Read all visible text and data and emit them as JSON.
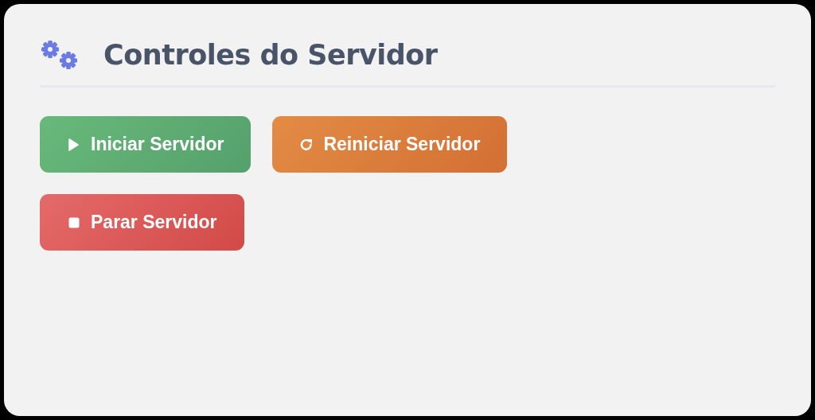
{
  "title": "Controles do Servidor",
  "buttons": [
    {
      "kind": "start",
      "label": "Iniciar Servidor"
    },
    {
      "kind": "restart",
      "label": "Reiniciar Servidor"
    },
    {
      "kind": "stop",
      "label": "Parar Servidor"
    }
  ]
}
